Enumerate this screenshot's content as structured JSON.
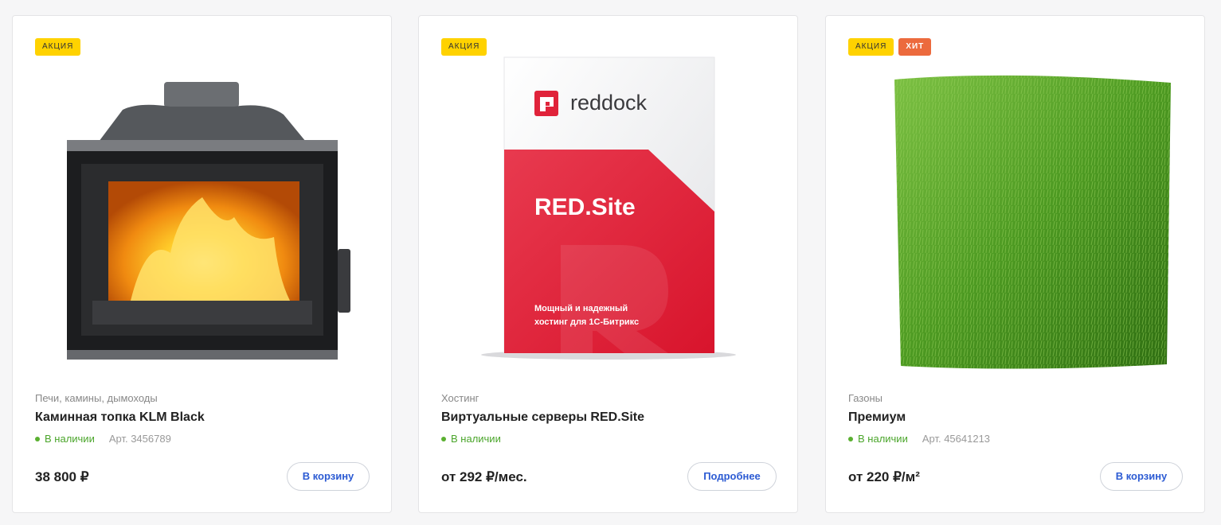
{
  "products": [
    {
      "badges": [
        "АКЦИЯ"
      ],
      "category": "Печи, камины, дымоходы",
      "title": "Каминная топка KLM Black",
      "stock": "В наличии",
      "article": "Арт. 3456789",
      "price": "38 800 ₽",
      "button": "В корзину"
    },
    {
      "badges": [
        "АКЦИЯ"
      ],
      "category": "Хостинг",
      "title": "Виртуальные серверы RED.Site",
      "stock": "В наличии",
      "price": "от 292 ₽/мес.",
      "button": "Подробнее",
      "box": {
        "brand": "reddock",
        "product": "RED.Site",
        "tagline_1": "Мощный и надежный",
        "tagline_2": "хостинг для 1С-Битрикс"
      }
    },
    {
      "badges": [
        "АКЦИЯ",
        "ХИТ"
      ],
      "category": "Газоны",
      "title": "Премиум",
      "stock": "В наличии",
      "article": "Арт. 45641213",
      "price": "от 220 ₽/м²",
      "button": "В корзину"
    }
  ],
  "colors": {
    "sale_badge": "#ffd200",
    "hit_badge": "#ec6a3d",
    "stock_green": "#4aa52a",
    "button_text": "#2c5bd3",
    "brand_red": "#e0233a"
  }
}
